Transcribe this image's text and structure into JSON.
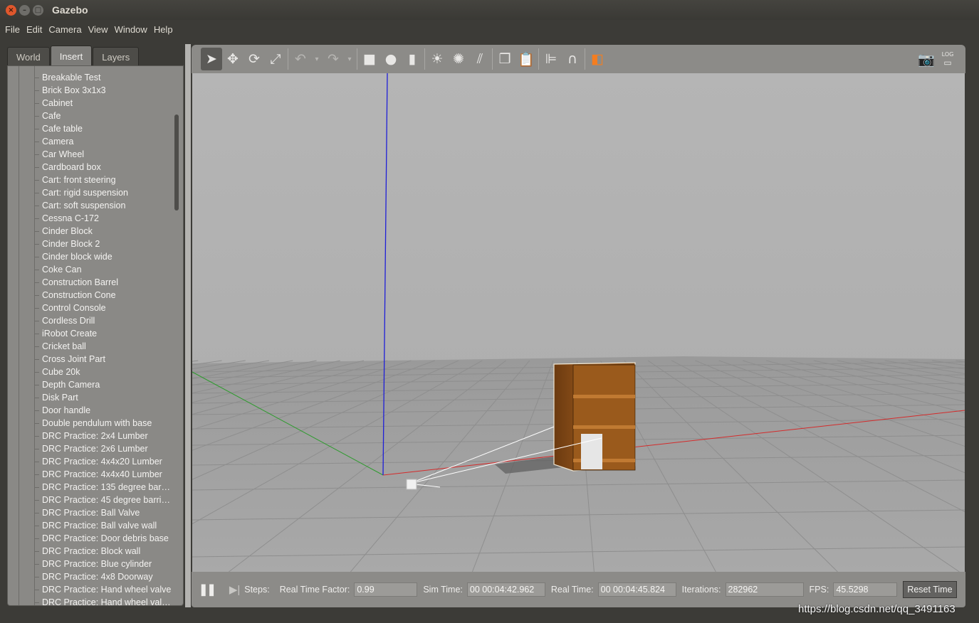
{
  "window": {
    "title": "Gazebo"
  },
  "menu": {
    "file": "File",
    "edit": "Edit",
    "camera": "Camera",
    "view": "View",
    "window": "Window",
    "help": "Help"
  },
  "tabs": {
    "world": "World",
    "insert": "Insert",
    "layers": "Layers",
    "active": "Insert"
  },
  "models": [
    "Breakable Test",
    "Brick Box 3x1x3",
    "Cabinet",
    "Cafe",
    "Cafe table",
    "Camera",
    "Car Wheel",
    "Cardboard box",
    "Cart: front steering",
    "Cart: rigid suspension",
    "Cart: soft suspension",
    "Cessna C-172",
    "Cinder Block",
    "Cinder Block 2",
    "Cinder block wide",
    "Coke Can",
    "Construction Barrel",
    "Construction Cone",
    "Control Console",
    "Cordless Drill",
    "iRobot Create",
    "Cricket ball",
    "Cross Joint Part",
    "Cube 20k",
    "Depth Camera",
    "Disk Part",
    "Door handle",
    "Double pendulum with base",
    "DRC Practice: 2x4 Lumber",
    "DRC Practice: 2x6 Lumber",
    "DRC Practice: 4x4x20 Lumber",
    "DRC Practice: 4x4x40 Lumber",
    "DRC Practice: 135 degree barri…",
    "DRC Practice: 45 degree barriers",
    "DRC Practice: Ball Valve",
    "DRC Practice: Ball valve wall",
    "DRC Practice: Door debris base",
    "DRC Practice: Block wall",
    "DRC Practice: Blue cylinder",
    "DRC Practice: 4x8 Doorway",
    "DRC Practice: Hand wheel valve",
    "DRC Practice: Hand wheel valv…"
  ],
  "toolbar": {
    "tools": [
      "select-arrow-icon",
      "translate-icon",
      "rotate-icon",
      "scale-icon",
      "undo-icon",
      "redo-icon",
      "box-icon",
      "sphere-icon",
      "cylinder-icon",
      "point-light-icon",
      "spot-light-icon",
      "directional-light-icon",
      "copy-icon",
      "paste-icon",
      "align-icon",
      "magnet-snap-icon",
      "view-angle-icon",
      "screenshot-icon",
      "log-icon"
    ],
    "log_label": "LOG"
  },
  "status": {
    "steps_label": "Steps:",
    "rtf_label": "Real Time Factor:",
    "rtf_value": "0.99",
    "sim_time_label": "Sim Time:",
    "sim_time_value": "00 00:04:42.962",
    "real_time_label": "Real Time:",
    "real_time_value": "00 00:04:45.824",
    "iterations_label": "Iterations:",
    "iterations_value": "282962",
    "fps_label": "FPS:",
    "fps_value": "45.5298",
    "reset_label": "Reset Time"
  },
  "watermark": "https://blog.csdn.net/qq_3491163",
  "colors": {
    "x_axis": "#d42b2b",
    "y_axis": "#2e9b2e",
    "z_axis": "#1f1fd8",
    "sky": "#b3b3b3",
    "ground": "#a0a0a0",
    "shelf": "#8b4c17"
  }
}
